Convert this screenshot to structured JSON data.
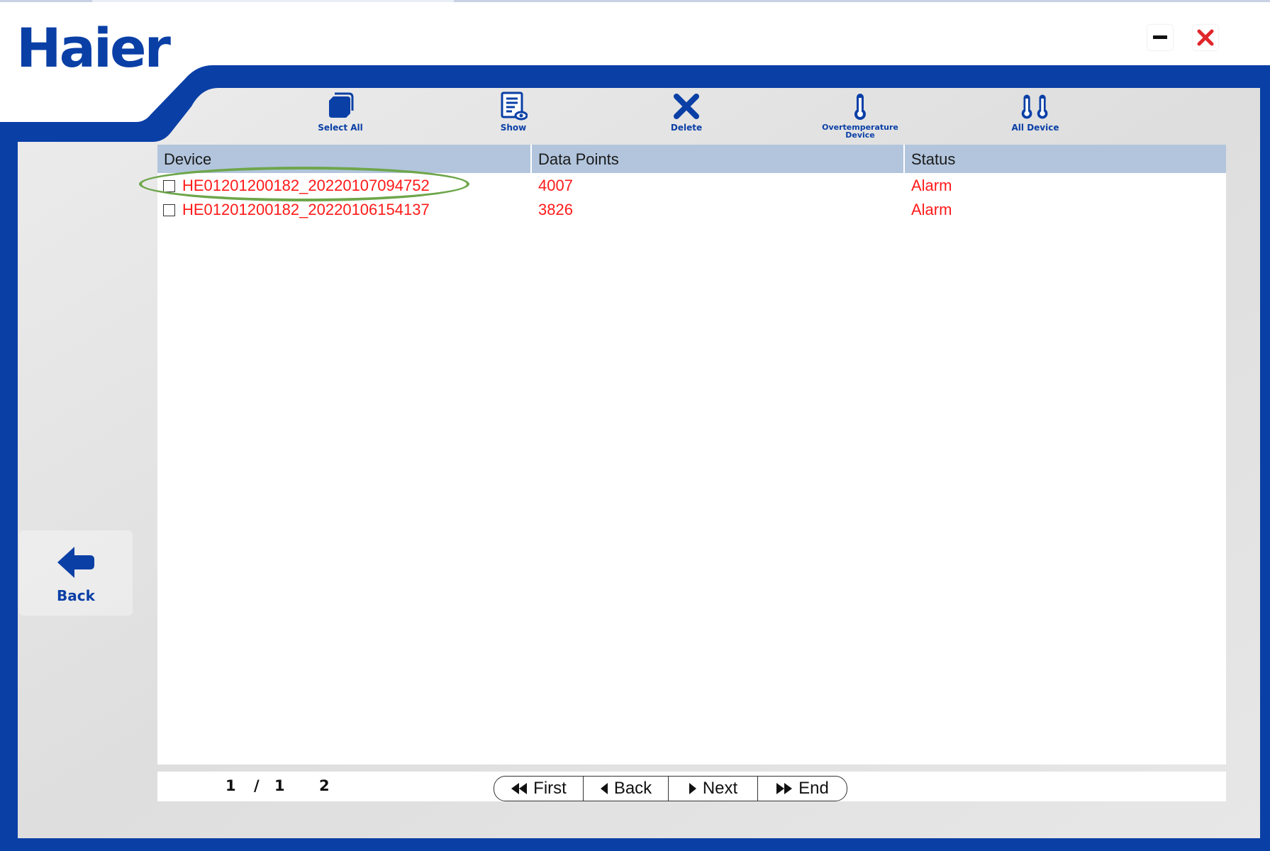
{
  "app": {
    "logo_text": "Haier"
  },
  "window_controls": {
    "minimize_icon": "minimize-icon",
    "close_icon": "close-icon",
    "close_color": "#e0262b"
  },
  "toolbar": {
    "select_all_label": "Select All",
    "show_label": "Show",
    "delete_label": "Delete",
    "overtemp_label_line1": "Overtemperature",
    "overtemp_label_line2": "Device",
    "all_device_label": "All Device"
  },
  "table": {
    "headers": {
      "device": "Device",
      "data_points": "Data Points",
      "status": "Status"
    },
    "rows": [
      {
        "device": "HE01201200182_20220107094752",
        "data_points": "4007",
        "status": "Alarm",
        "checked": false,
        "highlighted": true
      },
      {
        "device": "HE01201200182_20220106154137",
        "data_points": "3826",
        "status": "Alarm",
        "checked": false,
        "highlighted": false
      }
    ]
  },
  "pager": {
    "current_page": "1",
    "separator": "/",
    "total_pages": "1",
    "total_records": "2",
    "first_label": "First",
    "back_label": "Back",
    "next_label": "Next",
    "end_label": "End"
  },
  "side_nav": {
    "back_label": "Back"
  },
  "colors": {
    "brand": "#0a3fa6",
    "alarm_text": "#ff1a1a",
    "header_bg": "#b2c5dd",
    "highlight": "#6ea64b"
  }
}
